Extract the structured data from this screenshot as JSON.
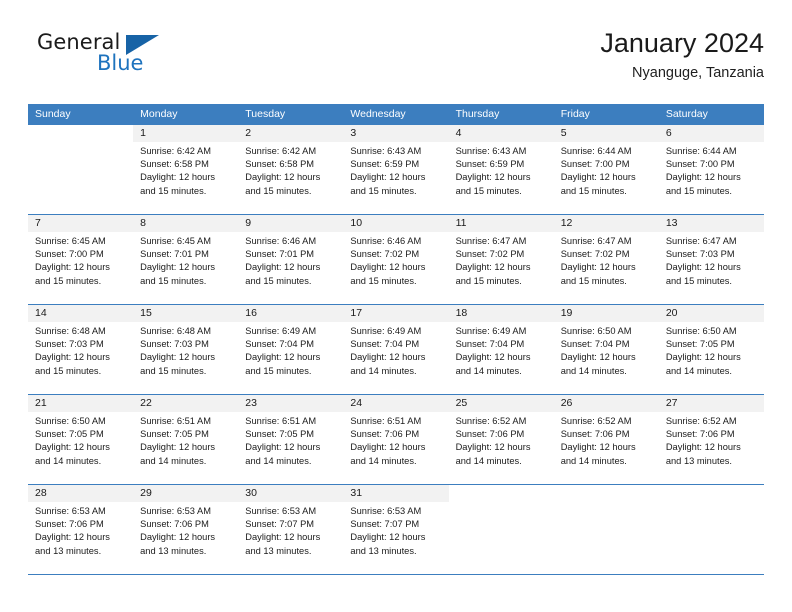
{
  "brand": {
    "name_part1": "General",
    "name_part2": "Blue",
    "triangle_color": "#1763a6",
    "blue_color": "#1e73be"
  },
  "header": {
    "title": "January 2024",
    "subtitle": "Nyanguge, Tanzania"
  },
  "theme": {
    "header_row_bg": "#3c7ebf",
    "header_row_text": "#ffffff",
    "shaded_cell_bg": "#f2f2f2",
    "grid_line": "#3c7ebf"
  },
  "weekdays": [
    "Sunday",
    "Monday",
    "Tuesday",
    "Wednesday",
    "Thursday",
    "Friday",
    "Saturday"
  ],
  "labels": {
    "sunrise_prefix": "Sunrise:",
    "sunset_prefix": "Sunset:",
    "daylight_prefix": "Daylight:"
  },
  "weeks": [
    [
      {
        "empty": true
      },
      {
        "day": "1",
        "sunrise": "Sunrise: 6:42 AM",
        "sunset": "Sunset: 6:58 PM",
        "daylight_line1": "Daylight: 12 hours",
        "daylight_line2": "and 15 minutes."
      },
      {
        "day": "2",
        "sunrise": "Sunrise: 6:42 AM",
        "sunset": "Sunset: 6:58 PM",
        "daylight_line1": "Daylight: 12 hours",
        "daylight_line2": "and 15 minutes."
      },
      {
        "day": "3",
        "sunrise": "Sunrise: 6:43 AM",
        "sunset": "Sunset: 6:59 PM",
        "daylight_line1": "Daylight: 12 hours",
        "daylight_line2": "and 15 minutes."
      },
      {
        "day": "4",
        "sunrise": "Sunrise: 6:43 AM",
        "sunset": "Sunset: 6:59 PM",
        "daylight_line1": "Daylight: 12 hours",
        "daylight_line2": "and 15 minutes."
      },
      {
        "day": "5",
        "sunrise": "Sunrise: 6:44 AM",
        "sunset": "Sunset: 7:00 PM",
        "daylight_line1": "Daylight: 12 hours",
        "daylight_line2": "and 15 minutes."
      },
      {
        "day": "6",
        "sunrise": "Sunrise: 6:44 AM",
        "sunset": "Sunset: 7:00 PM",
        "daylight_line1": "Daylight: 12 hours",
        "daylight_line2": "and 15 minutes."
      }
    ],
    [
      {
        "day": "7",
        "sunrise": "Sunrise: 6:45 AM",
        "sunset": "Sunset: 7:00 PM",
        "daylight_line1": "Daylight: 12 hours",
        "daylight_line2": "and 15 minutes."
      },
      {
        "day": "8",
        "sunrise": "Sunrise: 6:45 AM",
        "sunset": "Sunset: 7:01 PM",
        "daylight_line1": "Daylight: 12 hours",
        "daylight_line2": "and 15 minutes."
      },
      {
        "day": "9",
        "sunrise": "Sunrise: 6:46 AM",
        "sunset": "Sunset: 7:01 PM",
        "daylight_line1": "Daylight: 12 hours",
        "daylight_line2": "and 15 minutes."
      },
      {
        "day": "10",
        "sunrise": "Sunrise: 6:46 AM",
        "sunset": "Sunset: 7:02 PM",
        "daylight_line1": "Daylight: 12 hours",
        "daylight_line2": "and 15 minutes."
      },
      {
        "day": "11",
        "sunrise": "Sunrise: 6:47 AM",
        "sunset": "Sunset: 7:02 PM",
        "daylight_line1": "Daylight: 12 hours",
        "daylight_line2": "and 15 minutes."
      },
      {
        "day": "12",
        "sunrise": "Sunrise: 6:47 AM",
        "sunset": "Sunset: 7:02 PM",
        "daylight_line1": "Daylight: 12 hours",
        "daylight_line2": "and 15 minutes."
      },
      {
        "day": "13",
        "sunrise": "Sunrise: 6:47 AM",
        "sunset": "Sunset: 7:03 PM",
        "daylight_line1": "Daylight: 12 hours",
        "daylight_line2": "and 15 minutes."
      }
    ],
    [
      {
        "day": "14",
        "sunrise": "Sunrise: 6:48 AM",
        "sunset": "Sunset: 7:03 PM",
        "daylight_line1": "Daylight: 12 hours",
        "daylight_line2": "and 15 minutes."
      },
      {
        "day": "15",
        "sunrise": "Sunrise: 6:48 AM",
        "sunset": "Sunset: 7:03 PM",
        "daylight_line1": "Daylight: 12 hours",
        "daylight_line2": "and 15 minutes."
      },
      {
        "day": "16",
        "sunrise": "Sunrise: 6:49 AM",
        "sunset": "Sunset: 7:04 PM",
        "daylight_line1": "Daylight: 12 hours",
        "daylight_line2": "and 15 minutes."
      },
      {
        "day": "17",
        "sunrise": "Sunrise: 6:49 AM",
        "sunset": "Sunset: 7:04 PM",
        "daylight_line1": "Daylight: 12 hours",
        "daylight_line2": "and 14 minutes."
      },
      {
        "day": "18",
        "sunrise": "Sunrise: 6:49 AM",
        "sunset": "Sunset: 7:04 PM",
        "daylight_line1": "Daylight: 12 hours",
        "daylight_line2": "and 14 minutes."
      },
      {
        "day": "19",
        "sunrise": "Sunrise: 6:50 AM",
        "sunset": "Sunset: 7:04 PM",
        "daylight_line1": "Daylight: 12 hours",
        "daylight_line2": "and 14 minutes."
      },
      {
        "day": "20",
        "sunrise": "Sunrise: 6:50 AM",
        "sunset": "Sunset: 7:05 PM",
        "daylight_line1": "Daylight: 12 hours",
        "daylight_line2": "and 14 minutes."
      }
    ],
    [
      {
        "day": "21",
        "sunrise": "Sunrise: 6:50 AM",
        "sunset": "Sunset: 7:05 PM",
        "daylight_line1": "Daylight: 12 hours",
        "daylight_line2": "and 14 minutes."
      },
      {
        "day": "22",
        "sunrise": "Sunrise: 6:51 AM",
        "sunset": "Sunset: 7:05 PM",
        "daylight_line1": "Daylight: 12 hours",
        "daylight_line2": "and 14 minutes."
      },
      {
        "day": "23",
        "sunrise": "Sunrise: 6:51 AM",
        "sunset": "Sunset: 7:05 PM",
        "daylight_line1": "Daylight: 12 hours",
        "daylight_line2": "and 14 minutes."
      },
      {
        "day": "24",
        "sunrise": "Sunrise: 6:51 AM",
        "sunset": "Sunset: 7:06 PM",
        "daylight_line1": "Daylight: 12 hours",
        "daylight_line2": "and 14 minutes."
      },
      {
        "day": "25",
        "sunrise": "Sunrise: 6:52 AM",
        "sunset": "Sunset: 7:06 PM",
        "daylight_line1": "Daylight: 12 hours",
        "daylight_line2": "and 14 minutes."
      },
      {
        "day": "26",
        "sunrise": "Sunrise: 6:52 AM",
        "sunset": "Sunset: 7:06 PM",
        "daylight_line1": "Daylight: 12 hours",
        "daylight_line2": "and 14 minutes."
      },
      {
        "day": "27",
        "sunrise": "Sunrise: 6:52 AM",
        "sunset": "Sunset: 7:06 PM",
        "daylight_line1": "Daylight: 12 hours",
        "daylight_line2": "and 13 minutes."
      }
    ],
    [
      {
        "day": "28",
        "sunrise": "Sunrise: 6:53 AM",
        "sunset": "Sunset: 7:06 PM",
        "daylight_line1": "Daylight: 12 hours",
        "daylight_line2": "and 13 minutes."
      },
      {
        "day": "29",
        "sunrise": "Sunrise: 6:53 AM",
        "sunset": "Sunset: 7:06 PM",
        "daylight_line1": "Daylight: 12 hours",
        "daylight_line2": "and 13 minutes."
      },
      {
        "day": "30",
        "sunrise": "Sunrise: 6:53 AM",
        "sunset": "Sunset: 7:07 PM",
        "daylight_line1": "Daylight: 12 hours",
        "daylight_line2": "and 13 minutes."
      },
      {
        "day": "31",
        "sunrise": "Sunrise: 6:53 AM",
        "sunset": "Sunset: 7:07 PM",
        "daylight_line1": "Daylight: 12 hours",
        "daylight_line2": "and 13 minutes."
      },
      {
        "empty": true
      },
      {
        "empty": true
      },
      {
        "empty": true
      }
    ]
  ]
}
